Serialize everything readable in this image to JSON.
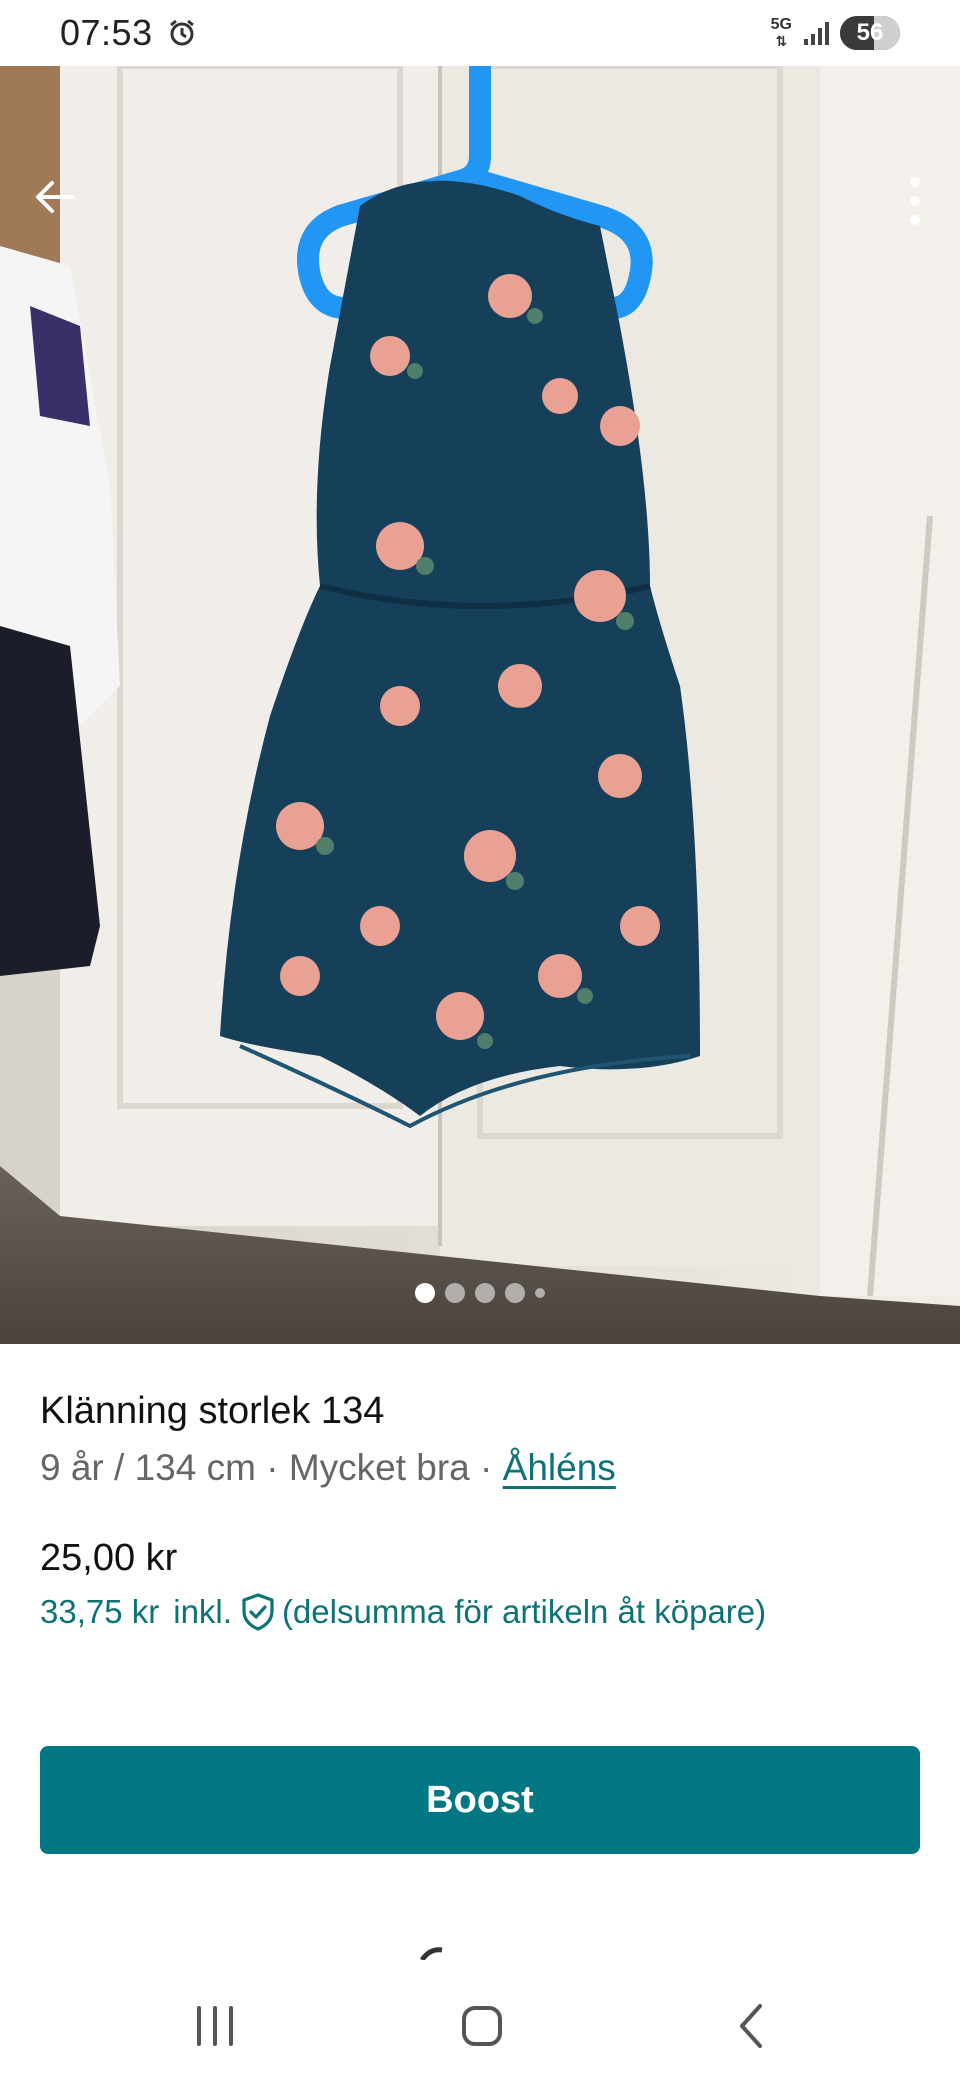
{
  "status_bar": {
    "time": "07:53",
    "network": "5G",
    "battery": "56",
    "battery_level": 0.56
  },
  "gallery": {
    "image_count": 5,
    "active_index": 0
  },
  "icons": {
    "back": "back-arrow-icon",
    "more": "more-vert-icon",
    "shield": "buyer-protection-shield-icon",
    "alarm": "alarm-icon",
    "signal": "signal-icon",
    "nav_recents": "recents-icon",
    "nav_home": "home-icon",
    "nav_back": "nav-back-icon"
  },
  "item": {
    "title": "Klänning storlek 134",
    "size": "9 år / 134 cm",
    "separator": "·",
    "condition": "Mycket bra",
    "brand": "Åhléns",
    "price": "25,00 kr",
    "price_incl": "33,75 kr",
    "incl_label": "inkl.",
    "incl_note": "(delsumma för artikeln åt köpare)"
  },
  "actions": {
    "boost_label": "Boost"
  },
  "colors": {
    "accent": "#007782",
    "link": "#0d7377",
    "dress": "#163f5a",
    "hanger": "#2196f3"
  }
}
